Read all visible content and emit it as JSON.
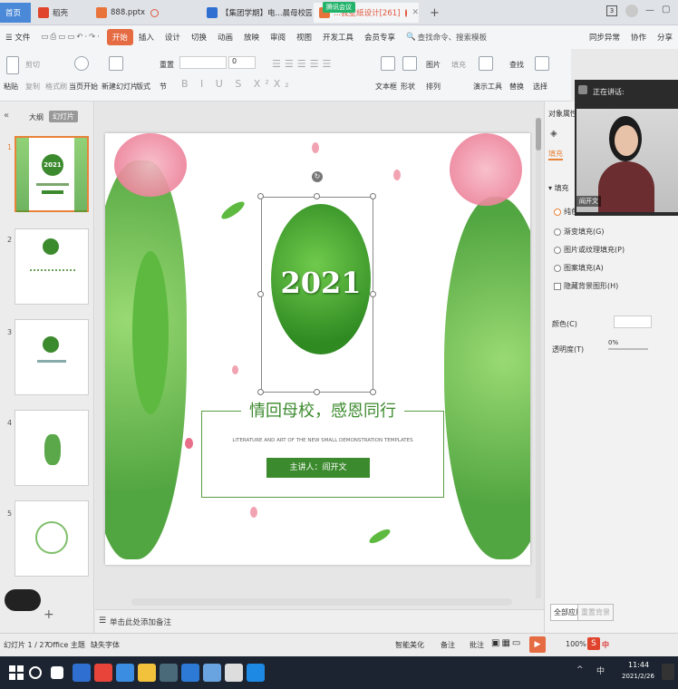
{
  "tabs": {
    "home": "首页",
    "docer": "稻壳",
    "file": "888.pptx",
    "web": "【集团学期】电...晨母校园话活动",
    "meeting_badge": "腾讯会议",
    "design": "...我壁纸设计[261]",
    "add": "+"
  },
  "window_controls": {
    "count": "3"
  },
  "menu": {
    "file": "文件",
    "start": "开始",
    "insert": "插入",
    "design": "设计",
    "transition": "切换",
    "animation": "动画",
    "slideshow": "放映",
    "review": "审阅",
    "view": "视图",
    "dev": "开发工具",
    "member": "会员专享",
    "search": "查找命令、搜索模板",
    "sync": "同步异常",
    "collab": "协作",
    "share": "分享"
  },
  "ribbon": {
    "paste": "粘贴",
    "cut": "剪切",
    "copy": "复制",
    "format_painter": "格式刷",
    "from_current": "当页开始",
    "new_slide": "新建幻灯片",
    "layout": "版式",
    "section": "节",
    "reset": "重置",
    "font_size": "0",
    "textbox": "文本框",
    "shape": "形状",
    "arrange": "排列",
    "picture": "图片",
    "fill": "填充",
    "find": "查找",
    "replace": "替换",
    "present_tools": "演示工具",
    "select": "选择"
  },
  "left_panel": {
    "outline": "大纲",
    "slides_tab": "幻灯片",
    "slide_numbers": [
      "1",
      "2",
      "3",
      "4",
      "5"
    ],
    "thumb_year": "2021",
    "add": "+"
  },
  "slide": {
    "year": "2021",
    "title": "情回母校，感恩同行",
    "subtitle": "LITERATURE AND ART OF THE NEW SMALL DEMONSTRATION TEMPLATES",
    "presenter": "主讲人：阎开文"
  },
  "notes": "单击此处添加备注",
  "right_panel": {
    "header": "对象属性",
    "fill_tab": "填充",
    "fill_section": "填充",
    "solid": "纯色填充",
    "gradient": "渐变填充(G)",
    "picture": "图片或纹理填充(P)",
    "pattern": "图案填充(A)",
    "hide_bg": "隐藏背景图形(H)",
    "color": "颜色(C)",
    "transparency": "透明度(T)",
    "transparency_value": "0%",
    "apply_all": "全部应用",
    "reset_bg": "重置背景"
  },
  "video": {
    "speaking": "正在讲话:",
    "name": "阎开文"
  },
  "status": {
    "slide_count": "幻灯片 1 / 27",
    "theme": "Office 主题",
    "missing_font": "缺失字体",
    "smart": "智能美化",
    "notes": "备注",
    "comment": "批注",
    "zoom": "100%"
  },
  "taskbar": {
    "time": "11:44",
    "date": "2021/2/26",
    "ime": "中",
    "ime2": "中"
  },
  "colors": {
    "accent": "#e56b42",
    "green": "#3c8a2e",
    "tab_home": "#4a88d8"
  }
}
